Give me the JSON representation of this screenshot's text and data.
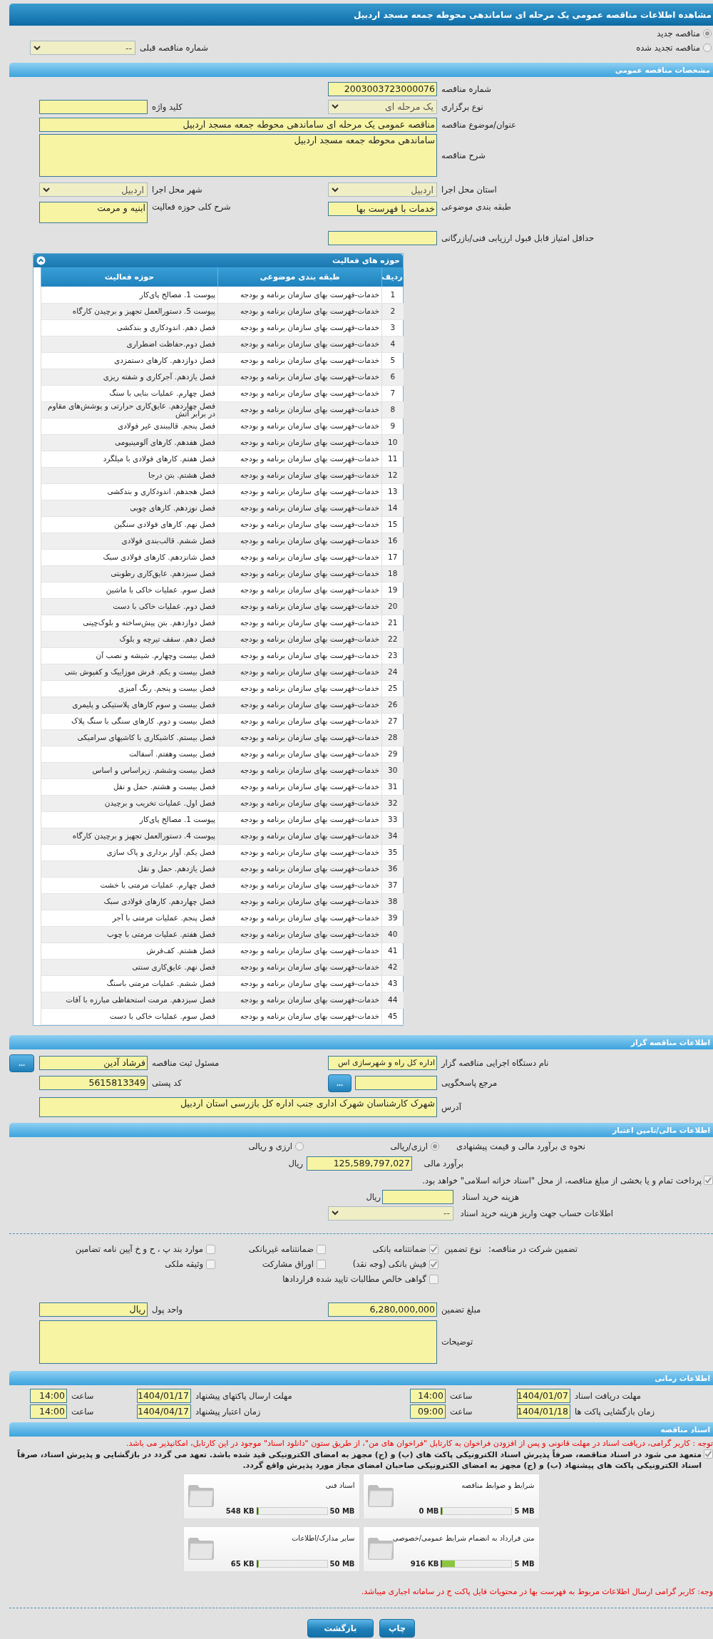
{
  "window": {
    "title": "مشاهده اطلاعات مناقصه عمومی یک مرحله ای ساماندهی محوطه جمعه مسجد اردبیل"
  },
  "tender_type": [
    {
      "label": "مناقصه جدید",
      "selected": true
    },
    {
      "label": "مناقصه تجدید شده",
      "selected": false
    }
  ],
  "previous_tender": {
    "label": "شماره مناقصه قبلی",
    "value": "--"
  },
  "general": {
    "title": "مشخصات مناقصه عمومی",
    "number": {
      "label": "شماره مناقصه",
      "value": "2003003723000076"
    },
    "holding_type": {
      "label": "نوع برگزاری",
      "value": "یک مرحله ای"
    },
    "keyword": {
      "label": "کلید واژه"
    },
    "subject": {
      "label": "عنوان/موضوع مناقصه",
      "value": "مناقصه عمومی یک مرحله ای ساماندهی محوطه جمعه مسجد اردبیل"
    },
    "description": {
      "label": "شرح مناقصه",
      "value": "ساماندهی محوطه جمعه مسجد اردبیل"
    },
    "province": {
      "label": "استان محل اجرا",
      "value": "اردبیل"
    },
    "city": {
      "label": "شهر محل اجرا",
      "value": "اردبیل"
    },
    "classification": {
      "label": "طبقه بندی موضوعی",
      "value": "خدمات با فهرست بها"
    },
    "activity_description": {
      "label": "شرح کلی حوزه فعالیت",
      "value": "ابنیه و مرمت"
    },
    "min_score": {
      "label": "حداقل امتیاز قابل قبول ارزیابی فنی/بازرگانی"
    }
  },
  "activities": {
    "title": "حوزه های فعالیت",
    "expanded": true,
    "columns": [
      "ردیف",
      "طبقه بندی موضوعی",
      "حوزه فعالیت"
    ],
    "rows": [
      {
        "row": "1",
        "category": "خدمات-فهرست بهای سازمان برنامه و بودجه",
        "activity": "پیوست 1. مصالح پای‌کار"
      },
      {
        "row": "2",
        "category": "خدمات-فهرست بهای سازمان برنامه و بودجه",
        "activity": "پیوست 5. دستورالعمل تجهیز و برچیدن کارگاه"
      },
      {
        "row": "3",
        "category": "خدمات-فهرست بهای سازمان برنامه و بودجه",
        "activity": "فصل دهم. اندودکاری و بندکشی"
      },
      {
        "row": "4",
        "category": "خدمات-فهرست بهای سازمان برنامه و بودجه",
        "activity": "فصل دوم.حفاظت اضطراری"
      },
      {
        "row": "5",
        "category": "خدمات-فهرست بهای سازمان برنامه و بودجه",
        "activity": "فصل دوازدهم. کارهای دستمزدی"
      },
      {
        "row": "6",
        "category": "خدمات-فهرست بهای سازمان برنامه و بودجه",
        "activity": "فصل یازدهم. آجرکاری و شفته ریزی"
      },
      {
        "row": "7",
        "category": "خدمات-فهرست بهای سازمان برنامه و بودجه",
        "activity": "فصل چهارم. عملیات بنایی با سنگ"
      },
      {
        "row": "8",
        "category": "خدمات-فهرست بهای سازمان برنامه و بودجه",
        "activity": "فصل چهاردهم. عایق‌کاری حرارتی و پوشش‌های مقاوم در برابر آتش"
      },
      {
        "row": "9",
        "category": "خدمات-فهرست بهای سازمان برنامه و بودجه",
        "activity": "فصل پنجم. قالببندی غیر فولادی"
      },
      {
        "row": "10",
        "category": "خدمات-فهرست بهای سازمان برنامه و بودجه",
        "activity": "فصل هفدهم. کارهای آلومینیومی"
      },
      {
        "row": "11",
        "category": "خدمات-فهرست بهای سازمان برنامه و بودجه",
        "activity": "فصل هفتم. کارهای فولادی با میلگرد"
      },
      {
        "row": "12",
        "category": "خدمات-فهرست بهای سازمان برنامه و بودجه",
        "activity": "فصل هشتم. بتن درجا"
      },
      {
        "row": "13",
        "category": "خدمات-فهرست بهای سازمان برنامه و بودجه",
        "activity": "فصل هجدهم. اندودکاری و بندکشی"
      },
      {
        "row": "14",
        "category": "خدمات-فهرست بهای سازمان برنامه و بودجه",
        "activity": "فصل نوزدهم. کارهای چوبی"
      },
      {
        "row": "15",
        "category": "خدمات-فهرست بهای سازمان برنامه و بودجه",
        "activity": "فصل نهم. کارهای فولادی سنگین"
      },
      {
        "row": "16",
        "category": "خدمات-فهرست بهای سازمان برنامه و بودجه",
        "activity": "فصل ششم. قالب‌بندی فولادی"
      },
      {
        "row": "17",
        "category": "خدمات-فهرست بهای سازمان برنامه و بودجه",
        "activity": "فصل شانزدهم. کارهای فولادی سبک"
      },
      {
        "row": "18",
        "category": "خدمات-فهرست بهای سازمان برنامه و بودجه",
        "activity": "فصل سیزدهم. عایق‌کاری رطوبتی"
      },
      {
        "row": "19",
        "category": "خدمات-فهرست بهای سازمان برنامه و بودجه",
        "activity": "فصل سوم. عملیات خاکی با ماشین"
      },
      {
        "row": "20",
        "category": "خدمات-فهرست بهای سازمان برنامه و بودجه",
        "activity": "فصل دوم. عملیات خاکی با دست"
      },
      {
        "row": "21",
        "category": "خدمات-فهرست بهای سازمان برنامه و بودجه",
        "activity": "فصل دوازدهم. بتن پیش‌ساخته و بلوک‌چینی"
      },
      {
        "row": "22",
        "category": "خدمات-فهرست بهای سازمان برنامه و بودجه",
        "activity": "فصل دهم. سقف تیرچه و بلوک"
      },
      {
        "row": "23",
        "category": "خدمات-فهرست بهای سازمان برنامه و بودجه",
        "activity": "فصل بیست وچهارم. شیشه و نصب آن"
      },
      {
        "row": "24",
        "category": "خدمات-فهرست بهای سازمان برنامه و بودجه",
        "activity": "فصل بیست و یکم. فرش موزاییک و کفپوش بتنی"
      },
      {
        "row": "25",
        "category": "خدمات-فهرست بهای سازمان برنامه و بودجه",
        "activity": "فصل بیست و پنجم. رنگ آمیزی"
      },
      {
        "row": "26",
        "category": "خدمات-فهرست بهای سازمان برنامه و بودجه",
        "activity": "فصل بیست و سوم کارهای پلاستیکی و پلیمری"
      },
      {
        "row": "27",
        "category": "خدمات-فهرست بهای سازمان برنامه و بودجه",
        "activity": "فصل بیست و دوم. کارهای سنگی با سنگ پلاک"
      },
      {
        "row": "28",
        "category": "خدمات-فهرست بهای سازمان برنامه و بودجه",
        "activity": "فصل بیستم. کاشیکاری با کاشیهای سرامیکی"
      },
      {
        "row": "29",
        "category": "خدمات-فهرست بهای سازمان برنامه و بودجه",
        "activity": "فصل بیست وهفتم. آسفالت"
      },
      {
        "row": "30",
        "category": "خدمات-فهرست بهای سازمان برنامه و بودجه",
        "activity": "فصل بیست وششم. زیراساس و اساس"
      },
      {
        "row": "31",
        "category": "خدمات-فهرست بهای سازمان برنامه و بودجه",
        "activity": "فصل بیست و هشتم. حمل و نقل"
      },
      {
        "row": "32",
        "category": "خدمات-فهرست بهای سازمان برنامه و بودجه",
        "activity": "فصل اول. عملیات تخریب و برچیدن"
      },
      {
        "row": "33",
        "category": "خدمات-فهرست بهای سازمان برنامه و بودجه",
        "activity": "پیوست 1. مصالح پای‌کار"
      },
      {
        "row": "34",
        "category": "خدمات-فهرست بهای سازمان برنامه و بودجه",
        "activity": "پیوست 4. دستورالعمل تجهیز و برچیدن کارگاه"
      },
      {
        "row": "35",
        "category": "خدمات-فهرست بهای سازمان برنامه و بودجه",
        "activity": "فصل یکم. آوار برداری و پاک سازی"
      },
      {
        "row": "36",
        "category": "خدمات-فهرست بهای سازمان برنامه و بودجه",
        "activity": "فصل یازدهم. حمل و نقل"
      },
      {
        "row": "37",
        "category": "خدمات-فهرست بهای سازمان برنامه و بودجه",
        "activity": "فصل چهارم. عملیات مرمتی با خشت"
      },
      {
        "row": "38",
        "category": "خدمات-فهرست بهای سازمان برنامه و بودجه",
        "activity": "فصل چهاردهم. کارهای فولادی سبک"
      },
      {
        "row": "39",
        "category": "خدمات-فهرست بهای سازمان برنامه و بودجه",
        "activity": "فصل پنجم. عملیات مرمتی با آجر"
      },
      {
        "row": "40",
        "category": "خدمات-فهرست بهای سازمان برنامه و بودجه",
        "activity": "فصل هفتم. عملیات مرمتی با چوب"
      },
      {
        "row": "41",
        "category": "خدمات-فهرست بهای سازمان برنامه و بودجه",
        "activity": "فصل هشتم. کف‌فرش"
      },
      {
        "row": "42",
        "category": "خدمات-فهرست بهای سازمان برنامه و بودجه",
        "activity": "فصل نهم. عایق‌کاری سنتی"
      },
      {
        "row": "43",
        "category": "خدمات-فهرست بهای سازمان برنامه و بودجه",
        "activity": "فصل ششم. عملیات مرمتی باسنگ"
      },
      {
        "row": "44",
        "category": "خدمات-فهرست بهای سازمان برنامه و بودجه",
        "activity": "فصل سیزدهم. مرمت استحفاظی مبارزه با آفات"
      },
      {
        "row": "45",
        "category": "خدمات-فهرست بهای سازمان برنامه و بودجه",
        "activity": "فصل سوم. عملیات خاکی با دست"
      }
    ]
  },
  "organizer": {
    "title": "اطلاعات مناقصه گزار",
    "agency": {
      "label": "نام دستگاه اجرایی مناقصه گزار",
      "value": "اداره کل راه و شهرسازی اس"
    },
    "registrar": {
      "label": "مسئول ثبت مناقصه",
      "value": "فرشاد آدین",
      "button": "..."
    },
    "reference": {
      "label": "مرجع پاسخگویی",
      "button": "..."
    },
    "postal_code": {
      "label": "کد پستی",
      "value": "5615813349"
    },
    "address": {
      "label": "آدرس",
      "value": "شهرک کارشناسان شهرک اداری جنب اداره کل بازرسی استان اردبیل"
    }
  },
  "finance": {
    "title": "اطلاعات مالی/تامین اعتبار",
    "pricing": {
      "label": "نحوه ی برآورد مالی و قیمت پیشنهادی",
      "options": [
        {
          "label": "ارزی/ریالی",
          "selected": true
        },
        {
          "label": "ارزی و ریالی",
          "selected": false
        }
      ]
    },
    "estimate": {
      "label": "برآورد مالی",
      "value": "125,589,797,027",
      "unit": "ریال"
    },
    "treasury": {
      "label": "پرداخت تمام و یا بخشی از مبلغ مناقصه، از محل \"اسناد خزانه اسلامی\" خواهد بود.",
      "checked": true
    },
    "document_fee": {
      "label": "هزینه خرید اسناد",
      "unit": "ریال"
    },
    "account": {
      "label": "اطلاعات حساب جهت واریز هزینه خرید اسناد",
      "value": "--"
    },
    "guarantee": {
      "label": "تضمین شرکت در مناقصه:",
      "type_label": "نوع تضمین",
      "options": [
        {
          "label": "ضمانتنامه بانکی",
          "checked": true
        },
        {
          "label": "ضمانتنامه غیربانکی",
          "checked": false
        },
        {
          "label": "موارد بند پ ، ح و خ آیین نامه تضامین",
          "checked": false
        },
        {
          "label": "فیش بانکی (وجه نقد)",
          "checked": true
        },
        {
          "label": "اوراق مشارکت",
          "checked": false
        },
        {
          "label": "وثیقه ملکی",
          "checked": false
        },
        {
          "label": "گواهی خالص مطالبات تایید شده قراردادها",
          "checked": false
        }
      ]
    },
    "amount": {
      "label": "مبلغ تضمین",
      "value": "6,280,000,000"
    },
    "currency": {
      "label": "واحد پول",
      "value": "ریال"
    },
    "remarks": {
      "label": "توضیحات"
    }
  },
  "timing": {
    "title": "اطلاعات زمانی",
    "items": [
      {
        "label": "مهلت دریافت اسناد",
        "date": "1404/01/07",
        "time_label": "ساعت",
        "time": "14:00"
      },
      {
        "label": "مهلت ارسال پاکتهای پیشنهاد",
        "date": "1404/01/17",
        "time_label": "ساعت",
        "time": "14:00"
      },
      {
        "label": "زمان بازگشایی پاکت ها",
        "date": "1404/01/18",
        "time_label": "ساعت",
        "time": "09:00"
      },
      {
        "label": "زمان اعتبار پیشنهاد",
        "date": "1404/04/17",
        "time_label": "ساعت",
        "time": "14:00"
      }
    ]
  },
  "documents": {
    "title": "اسناد مناقصه",
    "notice": "توجه : کاربر گرامی، دریافت اسناد در مهلت قانونی و پس از افزودن فراخوان به کارتابل \"فراخوان های من\"، از طریق ستون \"دانلود اسناد\" موجود در این کارتابل، امکانپذیر می باشد.",
    "commitment": {
      "checked": true,
      "text": "متعهد می شود در اسناد مناقصه، صرفاً پذیرش اسناد الکترونیکی پاکت های (ب) و (ج) مجهز به امضای الکترونیکی قید شده باشد. تعهد می گردد در بازگشایی و پذیرش اسناد، صرفاً اسناد الکترونیکی پاکت های پیشنهاد (ب) و (ج) مجهز به امضای الکترونیکی صاحبان امضای مجاز مورد پذیرش واقع گردد."
    },
    "files": [
      {
        "title": "شرایط و ضوابط مناقصه",
        "size": "0 MB",
        "max": "5 MB",
        "level": 0.01
      },
      {
        "title": "اسناد فنی",
        "size": "548 KB",
        "max": "50 MB",
        "level": 0.011
      },
      {
        "title": "متن قرارداد به انضمام شرایط عمومی/خصوصی",
        "size": "916 KB",
        "max": "5 MB",
        "level": 0.18
      },
      {
        "title": "سایر مدارک/اطلاعات",
        "size": "65 KB",
        "max": "50 MB",
        "level": 0.002
      }
    ],
    "footer_notice": "وجه: کاربر گرامی ارسال اطلاعات مربوط به فهرست بها در محتویات فایل پاکت ج در سامانه اجباری میباشد."
  },
  "buttons": [
    {
      "label": "چاپ"
    },
    {
      "label": "بازگشت"
    }
  ]
}
